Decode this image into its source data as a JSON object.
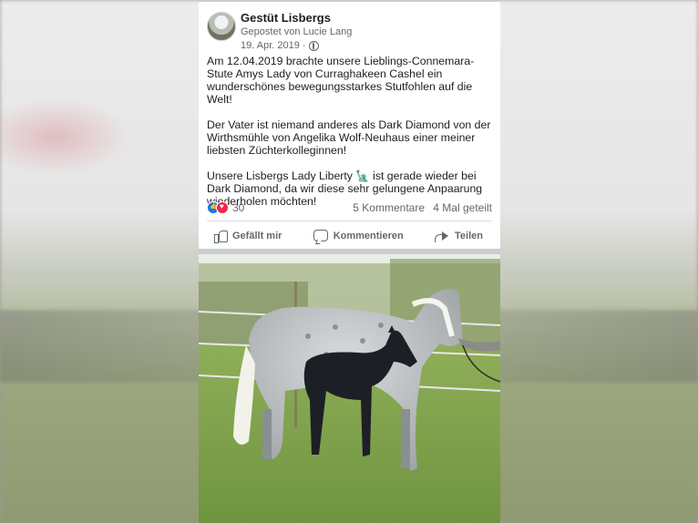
{
  "post": {
    "page_name": "Gestüt Lisbergs",
    "posted_by": "Gepostet von Lucie Lang",
    "date": "19. Apr. 2019",
    "separator": "·",
    "paragraphs": [
      "Am 12.04.2019 brachte unsere Lieblings-Connemara-Stute Amys Lady von Curraghakeen Cashel ein wunderschönes bewegungsstarkes Stutfohlen auf die Welt!",
      "Der Vater ist niemand anderes als Dark Diamond von der Wirthsmühle von Angelika Wolf-Neuhaus einer meiner liebsten Züchterkolleginnen!",
      "Unsere Lisbergs Lady Liberty 🗽 ist gerade wieder bei Dark Diamond, da wir diese sehr gelungene Anpaarung wiederholen möchten!"
    ],
    "reactions_count": "30",
    "comments_count": "5 Kommentare",
    "shares_count": "4 Mal geteilt",
    "actions": {
      "like": "Gefällt mir",
      "comment": "Kommentieren",
      "share": "Teilen"
    }
  },
  "icons": [
    "globe-icon",
    "like-reaction-icon",
    "love-reaction-icon",
    "like-icon",
    "comment-icon",
    "share-icon"
  ],
  "colors": {
    "like_blue": "#1b74e4",
    "love_red": "#f02849",
    "text": "#1c1e21",
    "muted": "#65676b"
  }
}
